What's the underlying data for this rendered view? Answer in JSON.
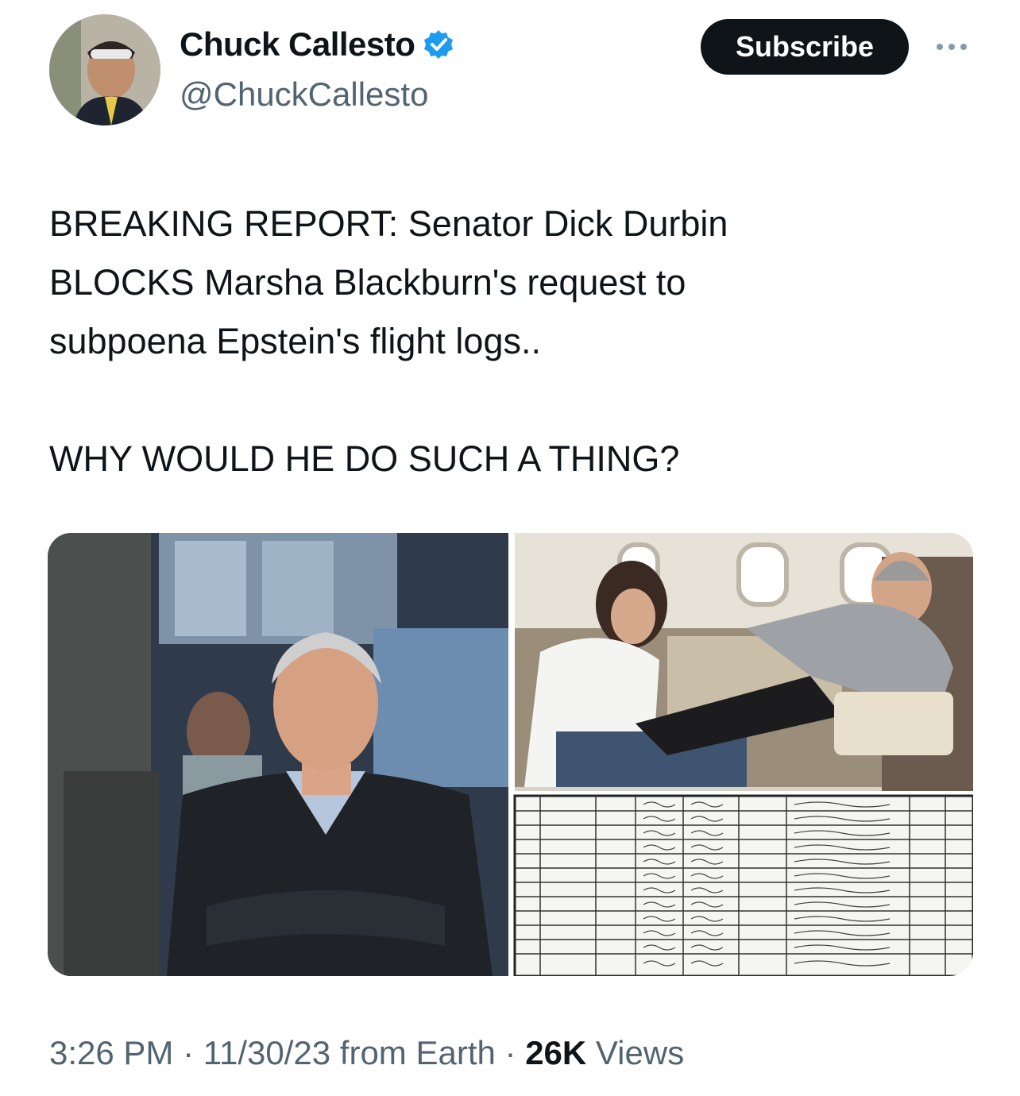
{
  "author": {
    "name": "Chuck Callesto",
    "handle": "@ChuckCallesto",
    "verified_color": "#1d9bf0"
  },
  "actions": {
    "subscribe_label": "Subscribe",
    "more_icon": "more-horizontal-icon"
  },
  "tweet": {
    "text": "BREAKING REPORT: Senator Dick Durbin\nBLOCKS Marsha Blackburn's request to\nsubpoena Epstein's flight logs..\n\nWHY WOULD HE DO SUCH A THING?"
  },
  "meta": {
    "time": "3:26 PM",
    "sep1": " · ",
    "date": "11/30/23",
    "source": " from Earth",
    "sep2": " · ",
    "views_count": "26K",
    "views_label": " Views"
  }
}
